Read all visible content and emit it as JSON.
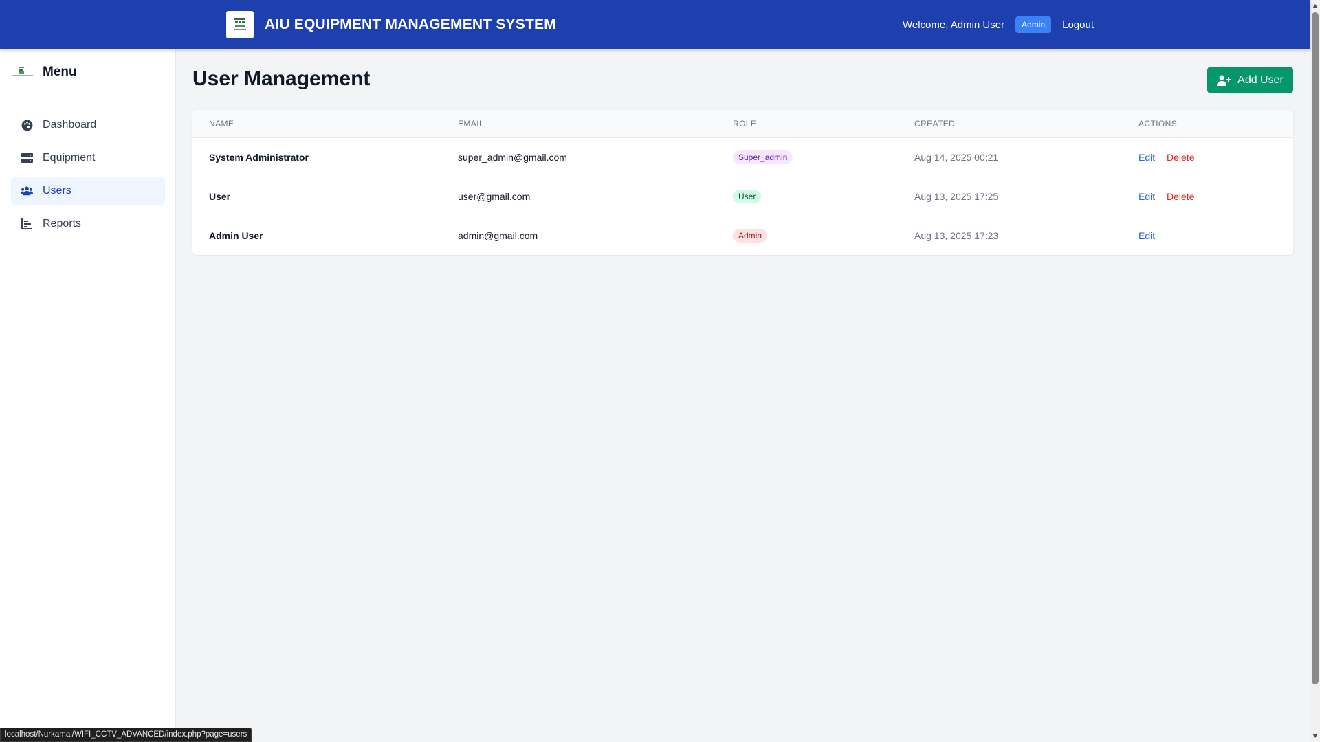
{
  "header": {
    "title": "AIU EQUIPMENT MANAGEMENT SYSTEM",
    "welcome": "Welcome, Admin User",
    "role_badge": "Admin",
    "logout": "Logout"
  },
  "sidebar": {
    "title": "Menu",
    "items": [
      {
        "label": "Dashboard",
        "icon": "palette-icon"
      },
      {
        "label": "Equipment",
        "icon": "server-icon"
      },
      {
        "label": "Users",
        "icon": "users-icon",
        "active": true
      },
      {
        "label": "Reports",
        "icon": "chart-bar-icon"
      }
    ]
  },
  "main": {
    "title": "User Management",
    "add_button": "Add User"
  },
  "table": {
    "headers": [
      "NAME",
      "EMAIL",
      "ROLE",
      "CREATED",
      "ACTIONS"
    ],
    "rows": [
      {
        "name": "System Administrator",
        "email": "super_admin@gmail.com",
        "role": "Super_admin",
        "role_color": "#6b21a8",
        "created": "Aug 14, 2025 00:21",
        "edit": "Edit",
        "delete": "Delete"
      },
      {
        "name": "User",
        "email": "user@gmail.com",
        "role": "User",
        "role_color": "#065f46",
        "created": "Aug 13, 2025 17:25",
        "edit": "Edit",
        "delete": "Delete"
      },
      {
        "name": "Admin User",
        "email": "admin@gmail.com",
        "role": "Admin",
        "role_color": "#991b1b",
        "created": "Aug 13, 2025 17:23",
        "edit": "Edit"
      }
    ]
  },
  "status_bar": {
    "url": "localhost/Nurkamal/WIFI_CCTV_ADVANCED/index.php?page=users"
  },
  "colors": {
    "header_bg": "#1e40af",
    "accent": "#059669",
    "link": "#2563eb",
    "danger": "#dc2626"
  }
}
